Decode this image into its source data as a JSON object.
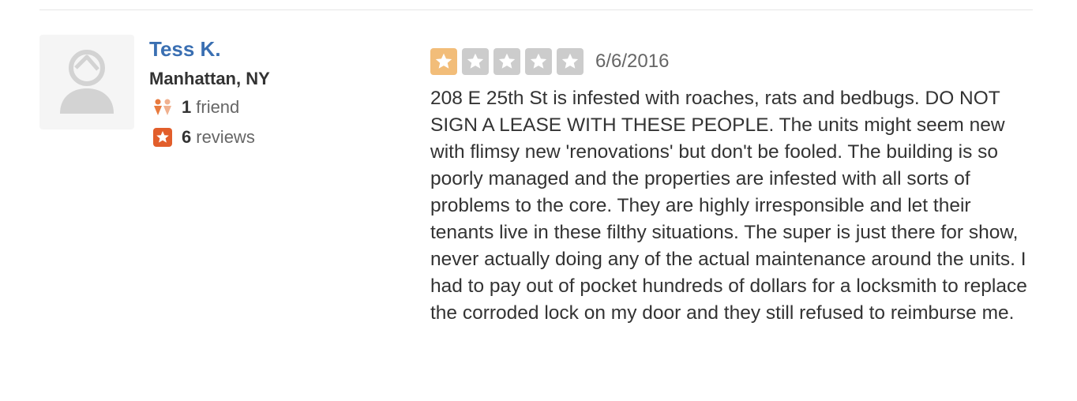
{
  "user": {
    "name": "Tess K.",
    "location": "Manhattan, NY",
    "friends_count": "1",
    "friends_label": "friend",
    "reviews_count": "6",
    "reviews_label": "reviews"
  },
  "review": {
    "rating": 1,
    "max_rating": 5,
    "date": "6/6/2016",
    "text": "208 E 25th St is infested with roaches, rats and bedbugs. DO NOT SIGN A LEASE WITH THESE PEOPLE. The units might seem new with flimsy new 'renovations' but don't be fooled. The building is so poorly managed and the properties are infested with all sorts of problems to the core. They are highly irresponsible and let their tenants live in these filthy situations. The super is just there for show, never actually doing any of the actual maintenance around the units. I had to pay out of pocket hundreds of dollars for a locksmith to replace the corroded lock on my door and they still refused to reimburse me."
  },
  "icons": {
    "avatar": "default-user-avatar",
    "friends": "friends-icon",
    "reviews": "review-star-icon",
    "rating_star": "star-icon"
  },
  "colors": {
    "user_name": "#3a6fb2",
    "star_filled": "#f2bd79",
    "star_empty": "#cccccc",
    "friends_icon": "#e87a3e",
    "reviews_icon": "#e25e2b"
  }
}
